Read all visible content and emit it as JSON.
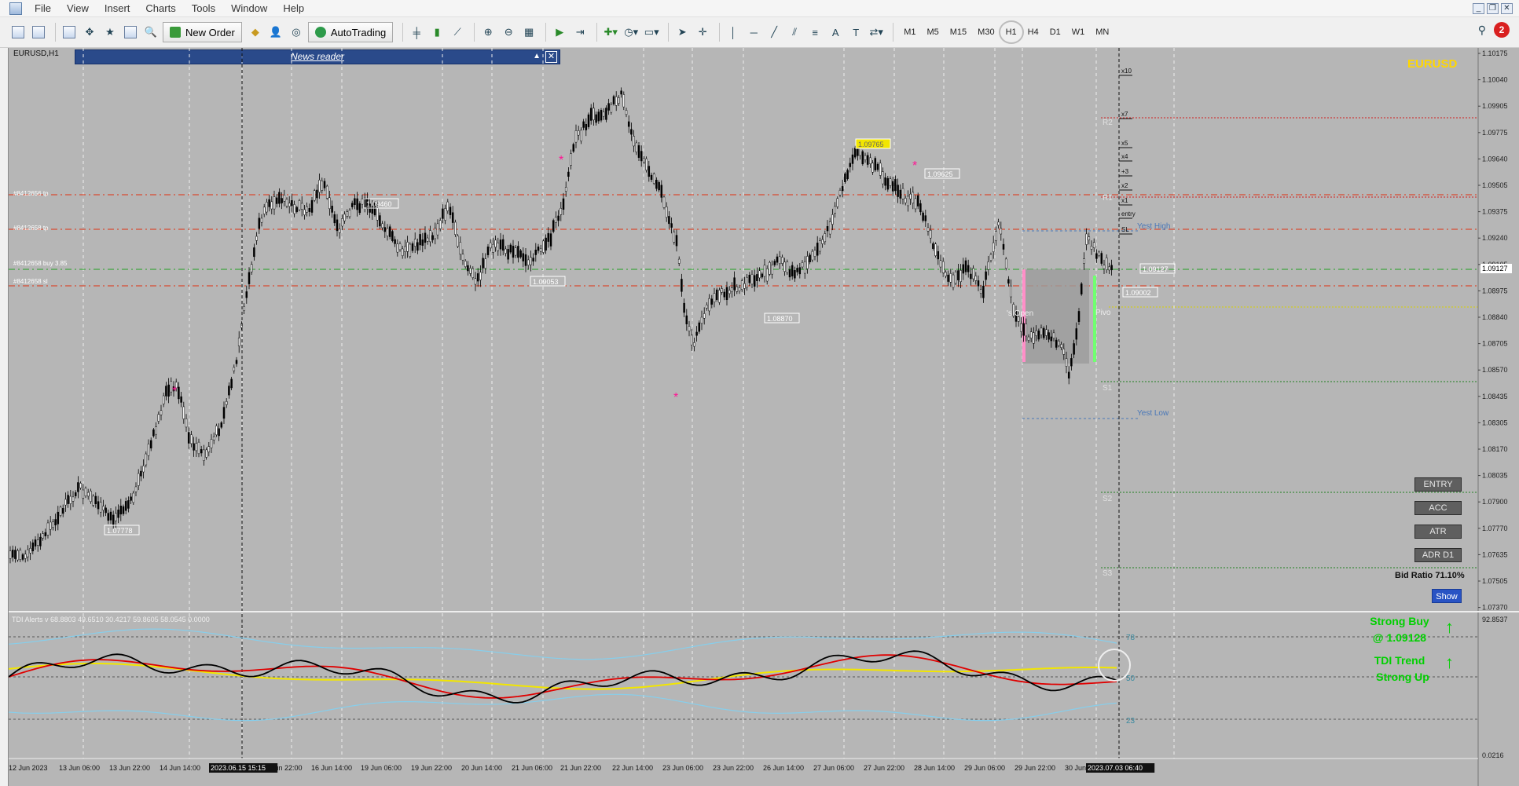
{
  "menu": {
    "items": [
      "File",
      "View",
      "Insert",
      "Charts",
      "Tools",
      "Window",
      "Help"
    ]
  },
  "toolbar": {
    "new_order": "New Order",
    "auto_trading": "AutoTrading",
    "timeframes": [
      "M1",
      "M5",
      "M15",
      "M30",
      "H1",
      "H4",
      "D1",
      "W1",
      "MN"
    ],
    "active_timeframe": "H1",
    "notifications": "2"
  },
  "chart": {
    "title": "EURUSD,H1",
    "symbol_watermark": "EURUSD",
    "news_reader": "News reader",
    "price_labels": [
      "1.10175",
      "1.10040",
      "1.09905",
      "1.09775",
      "1.09640",
      "1.09505",
      "1.09375",
      "1.09240",
      "1.09105",
      "1.08975",
      "1.08840",
      "1.08705",
      "1.08570",
      "1.08435",
      "1.08305",
      "1.08170",
      "1.08035",
      "1.07900",
      "1.07770",
      "1.07635",
      "1.07505",
      "1.07370"
    ],
    "current_price": "1.09127",
    "time_labels": [
      "12 Jun 2023",
      "13 Jun 06:00",
      "13 Jun 22:00",
      "14 Jun 14:00",
      "2023.06.15 15:15",
      "Jun 22:00",
      "16 Jun 14:00",
      "19 Jun 06:00",
      "19 Jun 22:00",
      "20 Jun 14:00",
      "21 Jun 06:00",
      "21 Jun 22:00",
      "22 Jun 14:00",
      "23 Jun 06:00",
      "23 Jun 22:00",
      "26 Jun 14:00",
      "27 Jun 06:00",
      "27 Jun 22:00",
      "28 Jun 14:00",
      "29 Jun 06:00",
      "29 Jun 22:00",
      "30 Jun",
      "2023.07.03 06:40"
    ],
    "order_lines": [
      "#8412656 tp",
      "#8412658 tp",
      "#8412658 buy 3.85",
      "#8412658 sl"
    ],
    "level_labels": [
      "R2",
      "R1",
      "S1",
      "S2",
      "S3",
      "Yest High",
      "Yest Low",
      "'s Open",
      "Pivo"
    ],
    "price_tags": [
      "1.09460",
      "1.09053",
      "1.08870",
      "1.07778",
      "1.09765",
      "1.09625",
      "1.09127",
      "1.09002"
    ],
    "multipliers": [
      "x10",
      "x7",
      "x5",
      "x4",
      "+3",
      "x2",
      "x1",
      "entry",
      "SL"
    ],
    "side_buttons": [
      "ENTRY",
      "ACC",
      "ATR",
      "ADR D1"
    ],
    "bid_ratio": "Bid Ratio 71.10%",
    "show_button": "Show"
  },
  "indicator": {
    "title": "TDI Alerts v 68.8803 49.6510 30.4217 59.8605 58.0545 0.0000",
    "levels": [
      "78",
      "50",
      "23"
    ],
    "axis_top": "92.8537",
    "axis_bottom": "0.0216",
    "signal_1": "Strong Buy",
    "signal_1_price": "@ 1.09128",
    "signal_2": "TDI Trend",
    "signal_2_value": "Strong Up"
  },
  "colors": {
    "chart_bg": "#b6b6b6",
    "candle": "#000000",
    "tp_line": "#e03010",
    "entry_line": "#20a020",
    "watermark": "#ffd700",
    "signal": "#00d000",
    "tdi_black": "#000000",
    "tdi_red": "#e00000",
    "tdi_yellow": "#f2e600",
    "tdi_blue": "#87ceeb"
  }
}
